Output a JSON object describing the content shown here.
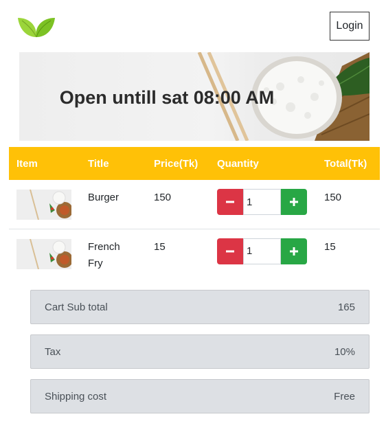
{
  "header": {
    "logo_icon": "leaf-icon",
    "login_label": "Login"
  },
  "banner": {
    "title": "Open untill sat 08:00 AM"
  },
  "cart": {
    "columns": [
      "Item",
      "Title",
      "Price(Tk)",
      "Quantity",
      "Total(Tk)"
    ],
    "rows": [
      {
        "title": "Burger",
        "price": "150",
        "quantity": "1",
        "total": "150"
      },
      {
        "title": "French Fry",
        "price": "15",
        "quantity": "1",
        "total": "15"
      }
    ]
  },
  "summary": [
    {
      "label": "Cart Sub total",
      "value": "165"
    },
    {
      "label": "Tax",
      "value": "10%"
    },
    {
      "label": "Shipping cost",
      "value": "Free"
    }
  ],
  "colors": {
    "header_row": "#ffc107",
    "minus": "#dc3545",
    "plus": "#28a745",
    "summary_bg": "#dde0e4"
  }
}
